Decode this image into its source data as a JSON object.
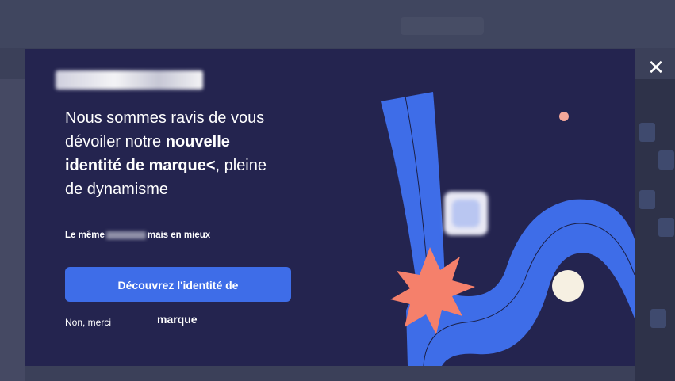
{
  "modal": {
    "headline_1": "Nous sommes ravis de vous dévoiler notre ",
    "headline_bold": "nouvelle identité de marque<",
    "headline_2": ", pleine de dynamisme",
    "subline_before": "Le même",
    "subline_after": "mais en mieux",
    "cta_label": "Découvrez l'identité de",
    "cta_overflow": "marque",
    "dismiss_label": "Non, merci"
  },
  "icons": {
    "close": "close-icon"
  },
  "colors": {
    "modal_bg": "#24244f",
    "cta_bg": "#3e6de8",
    "ribbon": "#3e6de8",
    "starburst": "#f5806b",
    "dot_peach": "#f5a89a",
    "circle_cream": "#f6f0e2"
  }
}
